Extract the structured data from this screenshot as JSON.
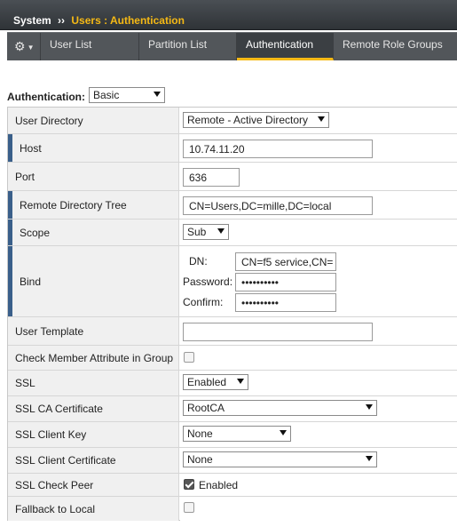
{
  "breadcrumb": {
    "system": "System",
    "separator": "››",
    "page": "Users : Authentication"
  },
  "tabs": [
    {
      "label": "User List"
    },
    {
      "label": "Partition List"
    },
    {
      "label": "Authentication",
      "active": true
    },
    {
      "label": "Remote Role Groups"
    }
  ],
  "icons": {
    "gear": "gear-icon",
    "caret": "caret-down-icon"
  },
  "accent_color": "#f5b915",
  "authentication": {
    "label": "Authentication:",
    "value": "Basic"
  },
  "form": {
    "user_directory": {
      "label": "User Directory",
      "value": "Remote - Active Directory"
    },
    "host": {
      "label": "Host",
      "value": "10.74.11.20"
    },
    "port": {
      "label": "Port",
      "value": "636"
    },
    "remote_directory_tree": {
      "label": "Remote Directory Tree",
      "value": "CN=Users,DC=mille,DC=local"
    },
    "scope": {
      "label": "Scope",
      "value": "Sub"
    },
    "bind": {
      "label": "Bind",
      "dn_label": "DN:",
      "dn_value": "CN=f5 service,CN=",
      "password_label": "Password:",
      "password_value": "••••••••••",
      "confirm_label": "Confirm:",
      "confirm_value": "••••••••••"
    },
    "user_template": {
      "label": "User Template",
      "value": ""
    },
    "check_member_attribute": {
      "label": "Check Member Attribute in Group",
      "checked": false
    },
    "ssl": {
      "label": "SSL",
      "value": "Enabled"
    },
    "ssl_ca_certificate": {
      "label": "SSL CA Certificate",
      "value": "RootCA"
    },
    "ssl_client_key": {
      "label": "SSL Client Key",
      "value": "None"
    },
    "ssl_client_certificate": {
      "label": "SSL Client Certificate",
      "value": "None"
    },
    "ssl_check_peer": {
      "label": "SSL Check Peer",
      "checked": true,
      "checkbox_label": "Enabled"
    },
    "fallback_to_local": {
      "label": "Fallback to Local",
      "checked": false
    }
  }
}
